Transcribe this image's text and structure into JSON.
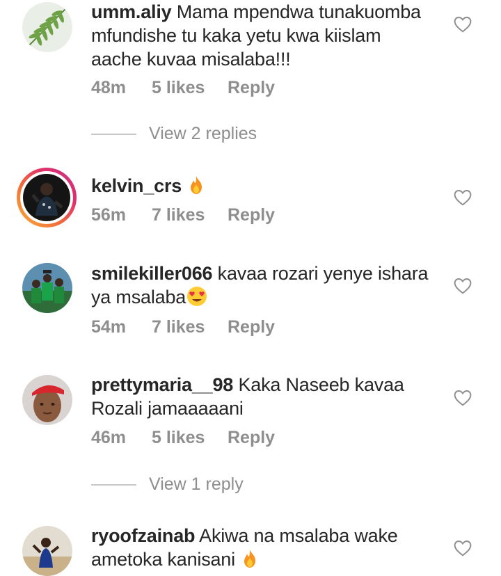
{
  "comments": [
    {
      "username": "umm.aliy",
      "lines": [
        "Mama mpendwa tunakuomba",
        "mfundishe tu kaka yetu kwa kiislam",
        "aache kuvaa misalaba!!!"
      ],
      "time": "48m",
      "likes": "5 likes",
      "reply": "Reply",
      "view_replies": "View 2 replies",
      "avatar_icon": "fern-leaf-avatar"
    },
    {
      "username": "kelvin_crs",
      "lines": [
        ""
      ],
      "emoji": "fire",
      "time": "56m",
      "likes": "7 likes",
      "reply": "Reply",
      "avatar_icon": "person-dark-avatar"
    },
    {
      "username": "smilekiller066",
      "lines": [
        "kavaa rozari yenye ishara",
        "ya msalaba"
      ],
      "emoji": "heart-eyes",
      "time": "54m",
      "likes": "7 likes",
      "reply": "Reply",
      "avatar_icon": "team-photo-avatar"
    },
    {
      "username": "prettymaria__98",
      "lines": [
        "Kaka Naseeb kavaa",
        "Rozali jamaaaaani"
      ],
      "time": "46m",
      "likes": "5 likes",
      "reply": "Reply",
      "view_replies": "View 1 reply",
      "avatar_icon": "woman-red-cap-avatar"
    },
    {
      "username": "ryoofzainab",
      "lines": [
        "Akiwa na msalaba wake",
        "ametoka kanisani"
      ],
      "emoji": "fire",
      "avatar_icon": "child-photo-avatar"
    }
  ],
  "colors": {
    "text": "#262626",
    "meta": "#8e8e8e",
    "divider": "#c7c7c7",
    "story_ring_start": "#f7b23b",
    "story_ring_end": "#c13584"
  }
}
